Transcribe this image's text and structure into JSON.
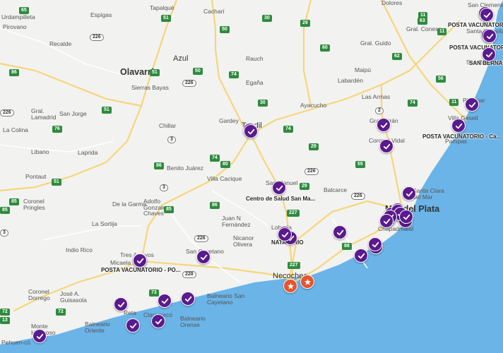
{
  "colors": {
    "land": "#f2f2f0",
    "ocean": "#6ab4e8",
    "road_main": "#f6d67a",
    "road_minor": "#ffffff",
    "marker": "#5b1a8e",
    "marker_star": "#e8532f",
    "shield": "#2e8b3e"
  },
  "towns": [
    {
      "name": "Dolores",
      "type": "town"
    },
    {
      "name": "Tapalqué",
      "type": "town"
    },
    {
      "name": "Espigas",
      "type": "town"
    },
    {
      "name": "Cacharí",
      "type": "town"
    },
    {
      "name": "Urdampilleta",
      "type": "town"
    },
    {
      "name": "Pirovano",
      "type": "town"
    },
    {
      "name": "Recalde",
      "type": "town"
    },
    {
      "name": "Gral. Conesa",
      "type": "town"
    },
    {
      "name": "Gral. Guido",
      "type": "town"
    },
    {
      "name": "Azul",
      "type": "city"
    },
    {
      "name": "Rauch",
      "type": "town"
    },
    {
      "name": "Olavarría",
      "type": "city"
    },
    {
      "name": "Sierras Bayas",
      "type": "town"
    },
    {
      "name": "Egaña",
      "type": "town"
    },
    {
      "name": "Labardén",
      "type": "town"
    },
    {
      "name": "Maipú",
      "type": "town"
    },
    {
      "name": "Las Armas",
      "type": "town"
    },
    {
      "name": "Ayacucho",
      "type": "town"
    },
    {
      "name": "Gral. Lamadrid",
      "type": "town"
    },
    {
      "name": "San Jorge",
      "type": "town"
    },
    {
      "name": "Chillar",
      "type": "town"
    },
    {
      "name": "Gardey",
      "type": "town"
    },
    {
      "name": "Tandil",
      "type": "city"
    },
    {
      "name": "Gral. Pirán",
      "type": "town"
    },
    {
      "name": "Coronel Vidal",
      "type": "town"
    },
    {
      "name": "Pinamar",
      "type": "town"
    },
    {
      "name": "Villa Gesell",
      "type": "town"
    },
    {
      "name": "Pampas",
      "type": "town"
    },
    {
      "name": "La Colina",
      "type": "town"
    },
    {
      "name": "Libano",
      "type": "town"
    },
    {
      "name": "Laprida",
      "type": "town"
    },
    {
      "name": "Pontaut",
      "type": "town"
    },
    {
      "name": "Benito Juárez",
      "type": "town"
    },
    {
      "name": "Villa Cacique",
      "type": "town"
    },
    {
      "name": "San Manuel",
      "type": "town"
    },
    {
      "name": "Balcarce",
      "type": "town"
    },
    {
      "name": "Santa Clara del Mar",
      "type": "town"
    },
    {
      "name": "Mar del Plata",
      "type": "city"
    },
    {
      "name": "Coronel Pringles",
      "type": "town"
    },
    {
      "name": "De la Garma",
      "type": "town"
    },
    {
      "name": "Adolfo Gonzales Chaves",
      "type": "town"
    },
    {
      "name": "La Sortija",
      "type": "town"
    },
    {
      "name": "Juan N Fernández",
      "type": "town"
    },
    {
      "name": "Lobería",
      "type": "town"
    },
    {
      "name": "Chapadmalal",
      "type": "town"
    },
    {
      "name": "Indio Rico",
      "type": "town"
    },
    {
      "name": "Tres Arroyos",
      "type": "town"
    },
    {
      "name": "San Cayetano",
      "type": "town"
    },
    {
      "name": "Nicanor Olivera",
      "type": "town"
    },
    {
      "name": "Micaela",
      "type": "town"
    },
    {
      "name": "Necochea",
      "type": "city"
    },
    {
      "name": "Coronel Dorrego",
      "type": "town"
    },
    {
      "name": "José A. Guisasola",
      "type": "town"
    },
    {
      "name": "Reta",
      "type": "town"
    },
    {
      "name": "Claromecó",
      "type": "town"
    },
    {
      "name": "Balneario San Cayetano",
      "type": "town"
    },
    {
      "name": "Balneario Orense",
      "type": "town"
    },
    {
      "name": "Balneario Oriente",
      "type": "town"
    },
    {
      "name": "Monte Hermoso",
      "type": "town"
    },
    {
      "name": "Pehuen-có",
      "type": "town"
    },
    {
      "name": "San Clemente",
      "type": "town"
    },
    {
      "name": "Santa Teresita",
      "type": "town"
    },
    {
      "name": "San Bernardo",
      "type": "town"
    }
  ],
  "poi_labels": [
    "POSTA VACUNATORIO - ...",
    "POSTA VACUNATORIO ...",
    "SAN BERNAR...",
    "POSTA VACUNATORIO - Ca...",
    "Centro de Salud San Ma...",
    "NATATORIO",
    "POSTA VACUNATORIO - PO..."
  ],
  "shields": [
    "65",
    "51",
    "30",
    "11",
    "50",
    "29",
    "63",
    "60",
    "11",
    "226",
    "62",
    "86",
    "51",
    "50",
    "226",
    "74",
    "56",
    "30",
    "2",
    "51",
    "226",
    "74",
    "11",
    "74",
    "3",
    "29",
    "55",
    "86",
    "74",
    "80",
    "226",
    "3",
    "29",
    "85",
    "76",
    "51",
    "86",
    "226",
    "227",
    "85",
    "88",
    "226",
    "228",
    "227",
    "72",
    "73",
    "3",
    "85",
    "72",
    "13"
  ],
  "marker_count": 39,
  "star_marker_count": 2
}
